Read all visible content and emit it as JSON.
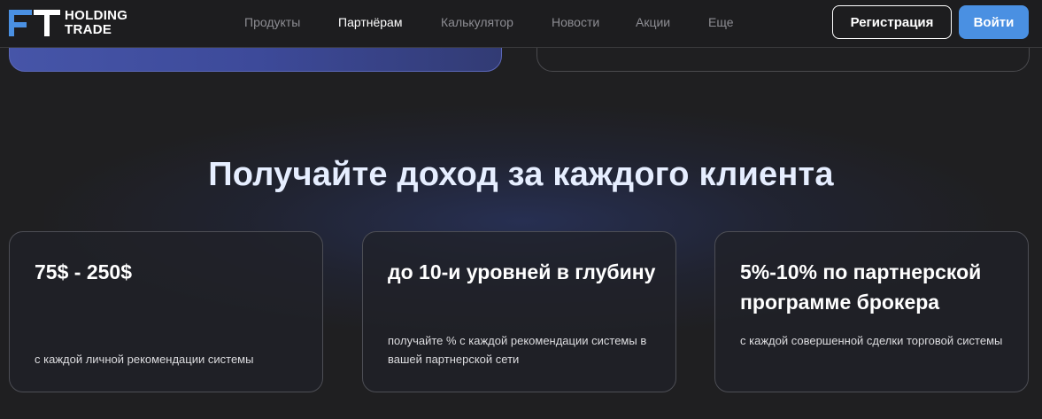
{
  "brand": {
    "logo_line1": "HOLDING",
    "logo_line2": "TRADE",
    "mark_color": "#4a90e2"
  },
  "nav": {
    "items": [
      {
        "label": "Продукты",
        "active": false
      },
      {
        "label": "Партнёрам",
        "active": true
      },
      {
        "label": "Калькулятор",
        "active": false
      },
      {
        "label": "Новости",
        "active": false
      },
      {
        "label": "Акции",
        "active": false
      },
      {
        "label": "Еще",
        "active": false
      }
    ]
  },
  "auth": {
    "register_label": "Регистрация",
    "login_label": "Войти"
  },
  "section": {
    "title": "Получайте доход за каждого клиента"
  },
  "cards": [
    {
      "title": "75$ - 250$",
      "desc": "с каждой личной рекомендации системы"
    },
    {
      "title": "до 10-и уровней в глубину",
      "desc": "получайте % с каждой рекомендации системы в вашей партнерской сети"
    },
    {
      "title": "5%-10% по партнерской программе брокера",
      "desc": "с каждой совершенной сделки торговой системы"
    }
  ],
  "colors": {
    "background": "#1f1f21",
    "accent": "#4a90e2",
    "title": "#e6eeff"
  }
}
